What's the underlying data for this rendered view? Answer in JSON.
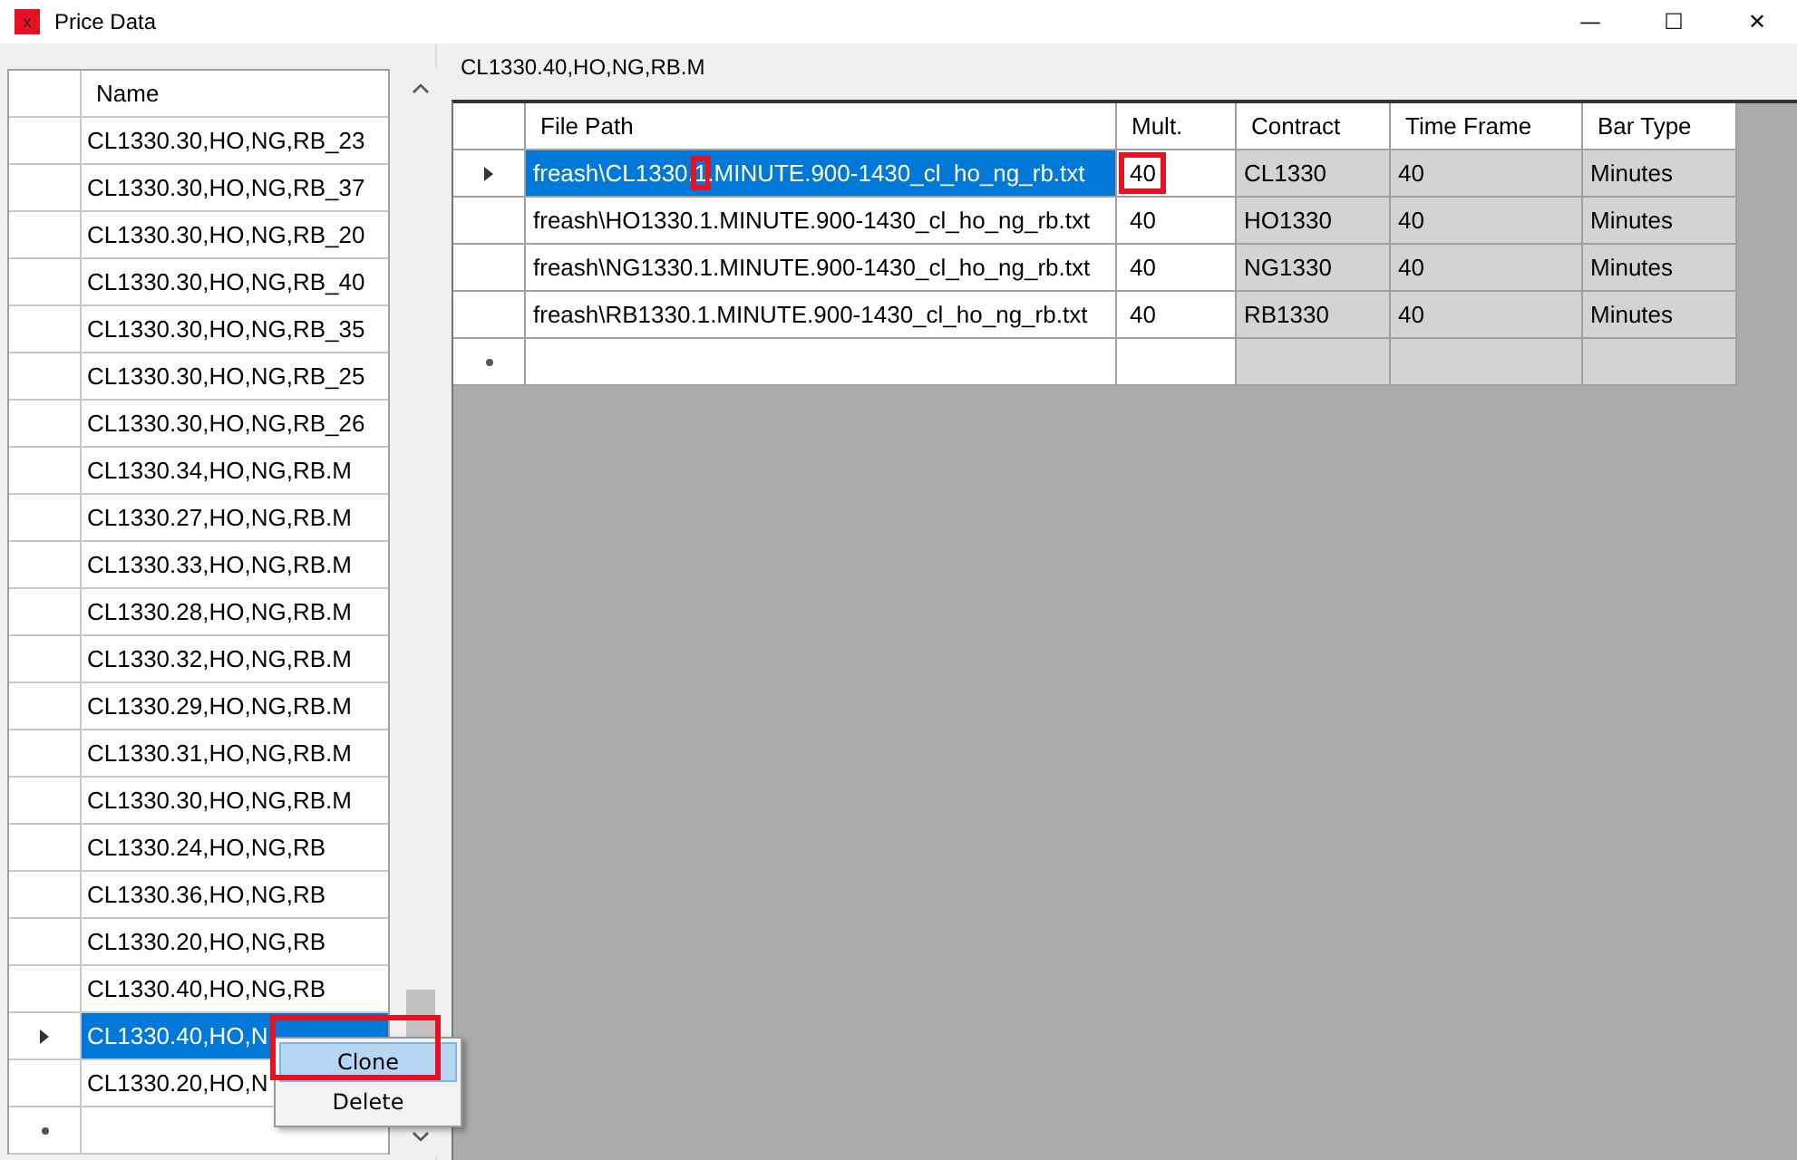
{
  "window": {
    "title": "Price Data",
    "icon_text": "x",
    "controls": [
      "—",
      "☐",
      "✕"
    ]
  },
  "names": {
    "header": "Name",
    "rows": [
      {
        "name": "CL1330.30,HO,NG,RB_23",
        "selected": false
      },
      {
        "name": "CL1330.30,HO,NG,RB_37",
        "selected": false
      },
      {
        "name": "CL1330.30,HO,NG,RB_20",
        "selected": false
      },
      {
        "name": "CL1330.30,HO,NG,RB_40",
        "selected": false
      },
      {
        "name": "CL1330.30,HO,NG,RB_35",
        "selected": false
      },
      {
        "name": "CL1330.30,HO,NG,RB_25",
        "selected": false
      },
      {
        "name": "CL1330.30,HO,NG,RB_26",
        "selected": false
      },
      {
        "name": "CL1330.34,HO,NG,RB.M",
        "selected": false
      },
      {
        "name": "CL1330.27,HO,NG,RB.M",
        "selected": false
      },
      {
        "name": "CL1330.33,HO,NG,RB.M",
        "selected": false
      },
      {
        "name": "CL1330.28,HO,NG,RB.M",
        "selected": false
      },
      {
        "name": "CL1330.32,HO,NG,RB.M",
        "selected": false
      },
      {
        "name": "CL1330.29,HO,NG,RB.M",
        "selected": false
      },
      {
        "name": "CL1330.31,HO,NG,RB.M",
        "selected": false
      },
      {
        "name": "CL1330.30,HO,NG,RB.M",
        "selected": false
      },
      {
        "name": "CL1330.24,HO,NG,RB",
        "selected": false
      },
      {
        "name": "CL1330.36,HO,NG,RB",
        "selected": false
      },
      {
        "name": "CL1330.20,HO,NG,RB",
        "selected": false
      },
      {
        "name": "CL1330.40,HO,NG,RB",
        "selected": false
      },
      {
        "name": "CL1330.40,HO,N",
        "selected": true
      },
      {
        "name": "CL1330.20,HO,N",
        "selected": false
      }
    ]
  },
  "context_menu": {
    "items": [
      {
        "label": "Clone",
        "hovered": true,
        "annotated": true
      },
      {
        "label": "Delete",
        "hovered": false,
        "annotated": false
      }
    ]
  },
  "group": {
    "title": "CL1330.40,HO,NG,RB.M"
  },
  "files": {
    "columns": [
      "File Path",
      "Mult.",
      "Contract",
      "Time Frame",
      "Bar Type"
    ],
    "rows": [
      {
        "selected": true,
        "path": [
          {
            "text": "freash\\CL1330.",
            "marked": false
          },
          {
            "text": "1",
            "marked": true
          },
          {
            "text": ".MINUTE.900-1430_cl_ho_ng_rb.txt",
            "marked": false
          }
        ],
        "mult": "40",
        "mult_annotated": true,
        "contract": "CL1330",
        "time_frame": "40",
        "bar_type": "Minutes"
      },
      {
        "selected": false,
        "path": [
          {
            "text": "freash\\HO1330.1.MINUTE.900-1430_cl_ho_ng_rb.txt",
            "marked": false
          }
        ],
        "mult": "40",
        "mult_annotated": false,
        "contract": "HO1330",
        "time_frame": "40",
        "bar_type": "Minutes"
      },
      {
        "selected": false,
        "path": [
          {
            "text": "freash\\NG1330.1.MINUTE.900-1430_cl_ho_ng_rb.txt",
            "marked": false
          }
        ],
        "mult": "40",
        "mult_annotated": false,
        "contract": "NG1330",
        "time_frame": "40",
        "bar_type": "Minutes"
      },
      {
        "selected": false,
        "path": [
          {
            "text": "freash\\RB1330.1.MINUTE.900-1430_cl_ho_ng_rb.txt",
            "marked": false
          }
        ],
        "mult": "40",
        "mult_annotated": false,
        "contract": "RB1330",
        "time_frame": "40",
        "bar_type": "Minutes"
      }
    ]
  }
}
